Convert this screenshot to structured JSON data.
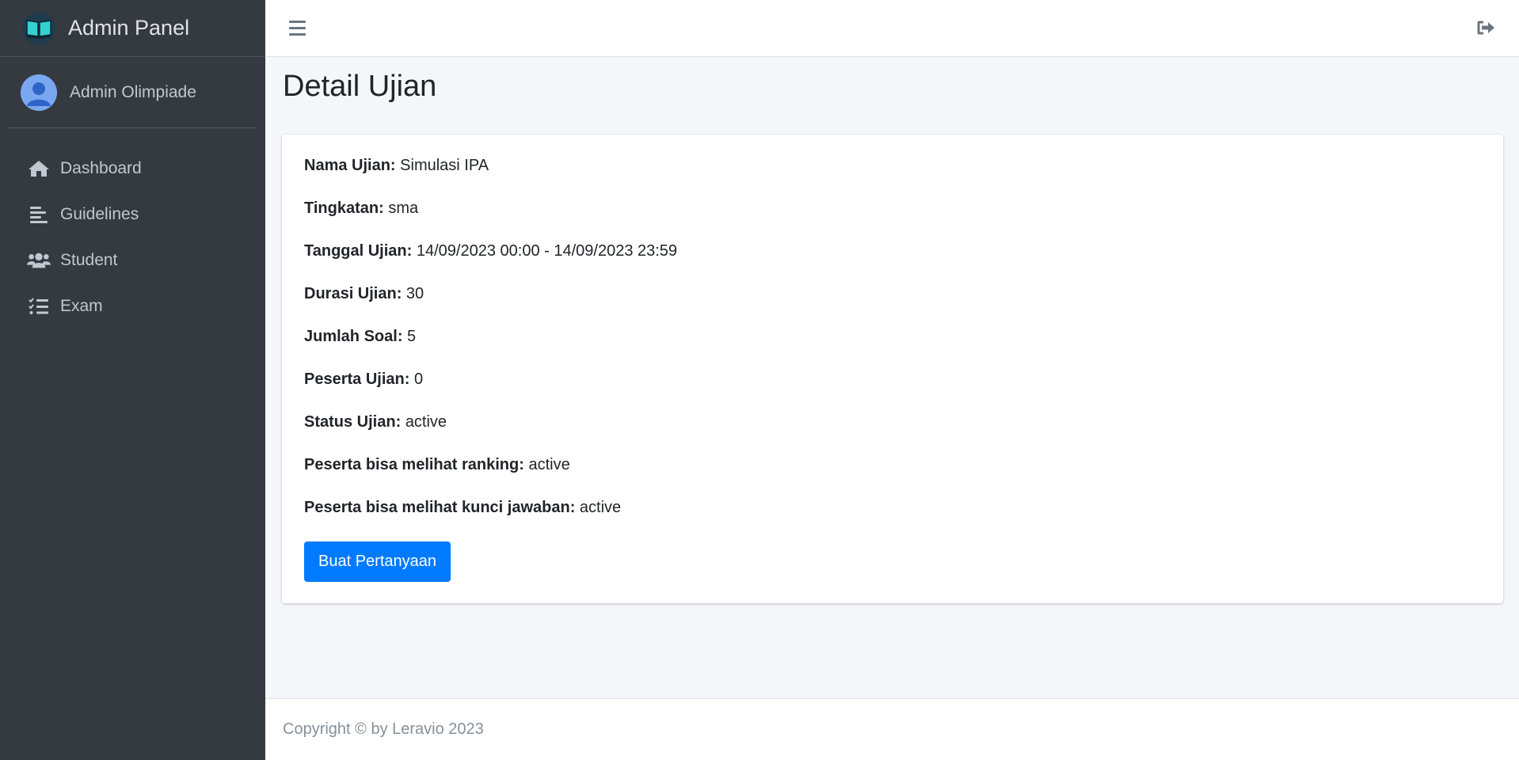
{
  "brand": {
    "title": "Admin Panel",
    "icon": "open-book-icon"
  },
  "user": {
    "name": "Admin Olimpiade",
    "avatar_icon": "user-avatar-icon"
  },
  "sidebar": {
    "items": [
      {
        "label": "Dashboard",
        "icon": "home-icon"
      },
      {
        "label": "Guidelines",
        "icon": "align-left-icon"
      },
      {
        "label": "Student",
        "icon": "users-icon"
      },
      {
        "label": "Exam",
        "icon": "list-check-icon"
      }
    ]
  },
  "header": {
    "menu_icon": "hamburger-icon",
    "logout_icon": "sign-out-icon"
  },
  "page": {
    "title": "Detail Ujian"
  },
  "details": [
    {
      "label": "Nama Ujian:",
      "value": "Simulasi IPA"
    },
    {
      "label": "Tingkatan:",
      "value": "sma"
    },
    {
      "label": "Tanggal Ujian:",
      "value": "14/09/2023 00:00 - 14/09/2023 23:59"
    },
    {
      "label": "Durasi Ujian:",
      "value": "30"
    },
    {
      "label": "Jumlah Soal:",
      "value": "5"
    },
    {
      "label": "Peserta Ujian:",
      "value": "0"
    },
    {
      "label": "Status Ujian:",
      "value": "active"
    },
    {
      "label": "Peserta bisa melihat ranking:",
      "value": "active"
    },
    {
      "label": "Peserta bisa melihat kunci jawaban:",
      "value": "active"
    }
  ],
  "actions": {
    "create_question_label": "Buat Pertanyaan"
  },
  "footer": {
    "text": "Copyright © by Leravio 2023"
  },
  "colors": {
    "sidebar_bg": "#343a40",
    "primary": "#007bff",
    "content_bg": "#f4f6f9"
  }
}
